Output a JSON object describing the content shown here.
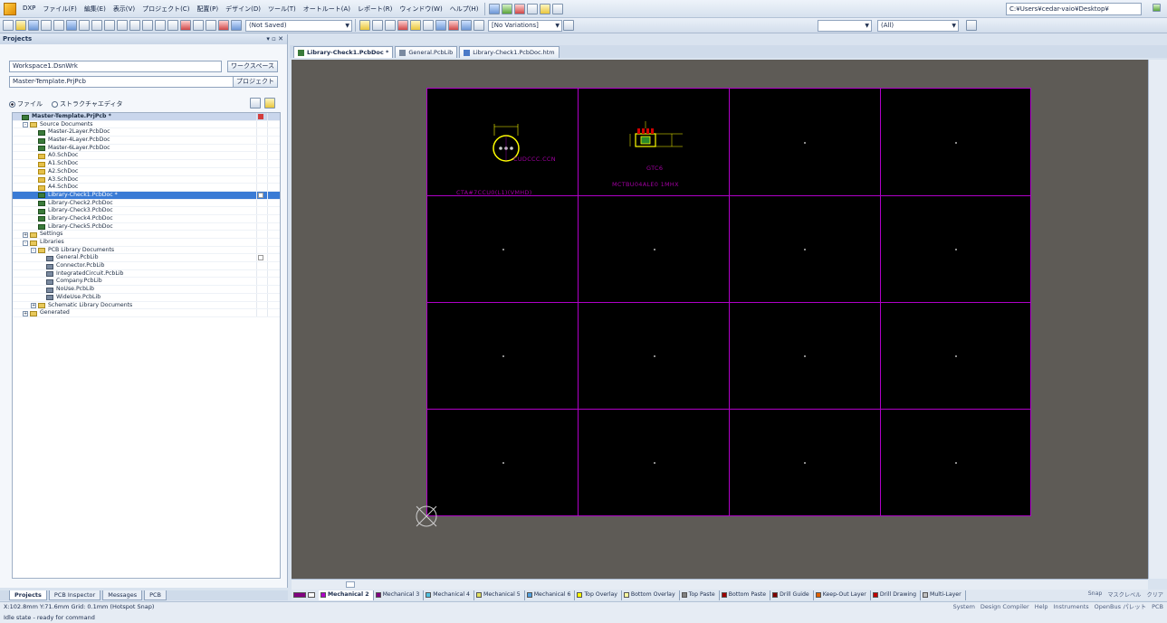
{
  "menubar": {
    "items": [
      "DXP",
      "ファイル(F)",
      "編集(E)",
      "表示(V)",
      "プロジェクト(C)",
      "配置(P)",
      "デザイン(D)",
      "ツール(T)",
      "オートルート(A)",
      "レポート(R)",
      "ウィンドウ(W)",
      "ヘルプ(H)"
    ],
    "path": "C:¥Users¥cedar-vaio¥Desktop¥"
  },
  "toolbar": {
    "saved_state": "(Not Saved)",
    "variations": "[No Variations]",
    "filter": "(All)"
  },
  "panel": {
    "title": "Projects",
    "workspace": "Workspace1.DsnWrk",
    "workspace_button": "ワークスペース",
    "project": "Master-Template.PrjPcb",
    "project_button": "プロジェクト",
    "view_file": "ファイル",
    "view_structure": "ストラクチャエディタ"
  },
  "tree": [
    {
      "indent": 0,
      "icon": "pcb",
      "label": "Master-Template.PrjPcb *",
      "style": "root",
      "flag": "red"
    },
    {
      "indent": 1,
      "icon": "folder",
      "label": "Source Documents",
      "exp": "-"
    },
    {
      "indent": 2,
      "icon": "pcb",
      "label": "Master-2Layer.PcbDoc"
    },
    {
      "indent": 2,
      "icon": "pcb",
      "label": "Master-4Layer.PcbDoc"
    },
    {
      "indent": 2,
      "icon": "pcb",
      "label": "Master-6Layer.PcbDoc"
    },
    {
      "indent": 2,
      "icon": "sch",
      "label": "A0.SchDoc"
    },
    {
      "indent": 2,
      "icon": "sch",
      "label": "A1.SchDoc"
    },
    {
      "indent": 2,
      "icon": "sch",
      "label": "A2.SchDoc"
    },
    {
      "indent": 2,
      "icon": "sch",
      "label": "A3.SchDoc"
    },
    {
      "indent": 2,
      "icon": "sch",
      "label": "A4.SchDoc"
    },
    {
      "indent": 2,
      "icon": "pcb",
      "label": "Library-Check1.PcbDoc *",
      "style": "sel",
      "flag": "white"
    },
    {
      "indent": 2,
      "icon": "pcb",
      "label": "Library-Check2.PcbDoc"
    },
    {
      "indent": 2,
      "icon": "pcb",
      "label": "Library-Check3.PcbDoc"
    },
    {
      "indent": 2,
      "icon": "pcb",
      "label": "Library-Check4.PcbDoc"
    },
    {
      "indent": 2,
      "icon": "pcb",
      "label": "Library-Check5.PcbDoc"
    },
    {
      "indent": 1,
      "icon": "folder",
      "label": "Settings",
      "exp": "+"
    },
    {
      "indent": 1,
      "icon": "folder",
      "label": "Libraries",
      "exp": "-"
    },
    {
      "indent": 2,
      "icon": "folder",
      "label": "PCB Library Documents",
      "exp": "-"
    },
    {
      "indent": 3,
      "icon": "lib",
      "label": "General.PcbLib",
      "flag": "white"
    },
    {
      "indent": 3,
      "icon": "lib",
      "label": "Connector.PcbLib"
    },
    {
      "indent": 3,
      "icon": "lib",
      "label": "IntegratedCircuit.PcbLib"
    },
    {
      "indent": 3,
      "icon": "lib",
      "label": "Company.PcbLib"
    },
    {
      "indent": 3,
      "icon": "lib",
      "label": "NoUse.PcbLib"
    },
    {
      "indent": 3,
      "icon": "lib",
      "label": "WideUse.PcbLib"
    },
    {
      "indent": 2,
      "icon": "folder",
      "label": "Schematic Library Documents",
      "exp": "+"
    },
    {
      "indent": 1,
      "icon": "folder",
      "label": "Generated",
      "exp": "+"
    }
  ],
  "doc_tabs": [
    {
      "label": "Library-Check1.PcbDoc *",
      "active": true,
      "icon": "pcb"
    },
    {
      "label": "General.PcbLib",
      "active": false,
      "icon": "lib"
    },
    {
      "label": "Library-Check1.PcbDoc.htm",
      "active": false,
      "icon": "web"
    }
  ],
  "board": {
    "components": [
      {
        "name": "CTA#7CCU0(L1)(VMHD)",
        "value": "CUDCCC.CCN"
      },
      {
        "name": "MCTBU04ALE0 1MHX",
        "value": "GTC6"
      }
    ]
  },
  "layers": [
    {
      "label": "Mechanical 2",
      "color": "#b000c8",
      "active": true
    },
    {
      "label": "Mechanical 3",
      "color": "#800080"
    },
    {
      "label": "Mechanical 4",
      "color": "#50c0e0"
    },
    {
      "label": "Mechanical 5",
      "color": "#e0e060"
    },
    {
      "label": "Mechanical 6",
      "color": "#50a0e0"
    },
    {
      "label": "Top Overlay",
      "color": "#ffff00"
    },
    {
      "label": "Bottom Overlay",
      "color": "#ffffa0"
    },
    {
      "label": "Top Paste",
      "color": "#808080"
    },
    {
      "label": "Bottom Paste",
      "color": "#a00000"
    },
    {
      "label": "Drill Guide",
      "color": "#800000"
    },
    {
      "label": "Keep-Out Layer",
      "color": "#e06000"
    },
    {
      "label": "Drill Drawing",
      "color": "#c00000"
    },
    {
      "label": "Multi-Layer",
      "color": "#c0c0c0"
    }
  ],
  "layer_right": [
    "Snap",
    "マスクレベル",
    "クリア"
  ],
  "panel_tabs": [
    {
      "label": "Projects",
      "active": true
    },
    {
      "label": "PCB Inspector",
      "active": false
    },
    {
      "label": "Messages",
      "active": false
    },
    {
      "label": "PCB",
      "active": false
    }
  ],
  "status": {
    "coords": "X:102.8mm Y:71.6mm   Grid: 0.1mm    (Hotspot Snap)",
    "right": [
      "System",
      "Design Compiler",
      "Help",
      "Instruments",
      "OpenBus パレット",
      "PCB"
    ],
    "info": "Idle state - ready for command"
  }
}
